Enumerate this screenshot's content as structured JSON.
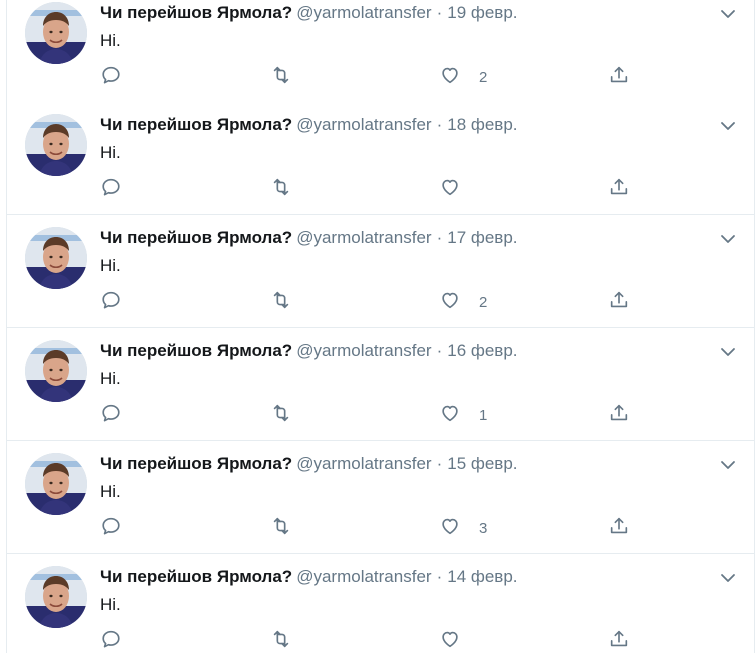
{
  "tweets": [
    {
      "name": "Чи перейшов Ярмола?",
      "handle": "@yarmolatransfer",
      "separator": "·",
      "date": "19 февр.",
      "text": "Hi.",
      "likes": "2"
    },
    {
      "name": "Чи перейшов Ярмола?",
      "handle": "@yarmolatransfer",
      "separator": "·",
      "date": "18 февр.",
      "text": "Hi.",
      "likes": ""
    },
    {
      "name": "Чи перейшов Ярмола?",
      "handle": "@yarmolatransfer",
      "separator": "·",
      "date": "17 февр.",
      "text": "Hi.",
      "likes": "2"
    },
    {
      "name": "Чи перейшов Ярмола?",
      "handle": "@yarmolatransfer",
      "separator": "·",
      "date": "16 февр.",
      "text": "Hi.",
      "likes": "1"
    },
    {
      "name": "Чи перейшов Ярмола?",
      "handle": "@yarmolatransfer",
      "separator": "·",
      "date": "15 февр.",
      "text": "Hi.",
      "likes": "3"
    },
    {
      "name": "Чи перейшов Ярмола?",
      "handle": "@yarmolatransfer",
      "separator": "·",
      "date": "14 февр.",
      "text": "Hi.",
      "likes": ""
    }
  ],
  "icons": {
    "reply": "reply-icon",
    "retweet": "retweet-icon",
    "like": "heart-icon",
    "share": "share-icon",
    "menu": "chevron-down-icon"
  },
  "colors": {
    "icon": "#657786",
    "border": "#e6ecf0",
    "text": "#14171a",
    "secondary": "#657786"
  }
}
